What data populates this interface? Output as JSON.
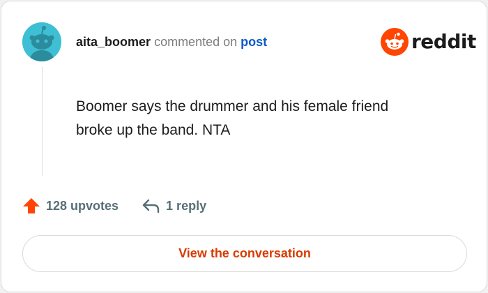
{
  "comment": {
    "author": "aita_boomer",
    "action_text": "commented on",
    "target_link": "post",
    "body": "Boomer says the drummer and his female friend broke up the band. NTA"
  },
  "brand": {
    "name": "reddit",
    "accent": "#ff4500"
  },
  "stats": {
    "upvotes_label": "128 upvotes",
    "replies_label": "1 reply"
  },
  "cta": {
    "label": "View the conversation"
  },
  "colors": {
    "avatar_bg": "#3ebfd3",
    "link": "#0a58ca",
    "cta_text": "#d93a00",
    "muted": "#576f76"
  }
}
